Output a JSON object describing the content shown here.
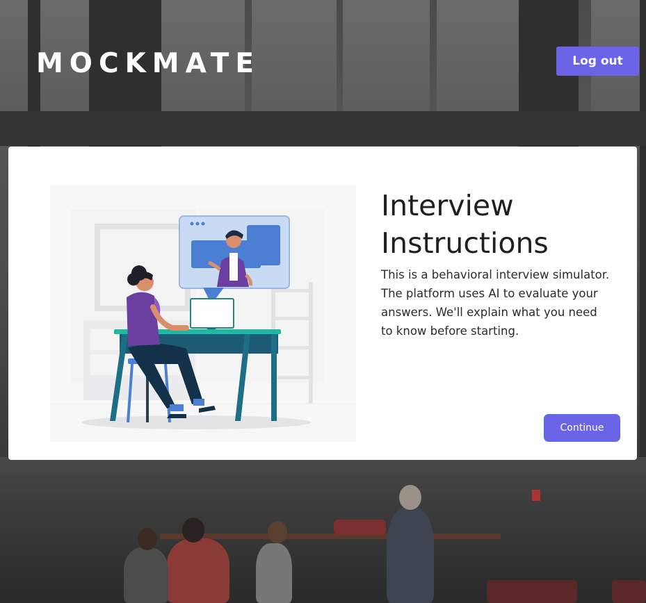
{
  "header": {
    "brand": "MOCKMATE",
    "logout_label": "Log out"
  },
  "card": {
    "title": "Interview Instructions",
    "description": "This is a behavioral interview simulator. The platform uses AI to evaluate your answers. We'll explain what you need to know before starting.",
    "continue_label": "Continue"
  },
  "colors": {
    "accent": "#6c63e6",
    "illustration_purple": "#6b3fa0",
    "illustration_blue": "#4a7fd4",
    "illustration_teal": "#1d6f86"
  },
  "icons": {
    "illustration": "video-interview-illustration"
  }
}
